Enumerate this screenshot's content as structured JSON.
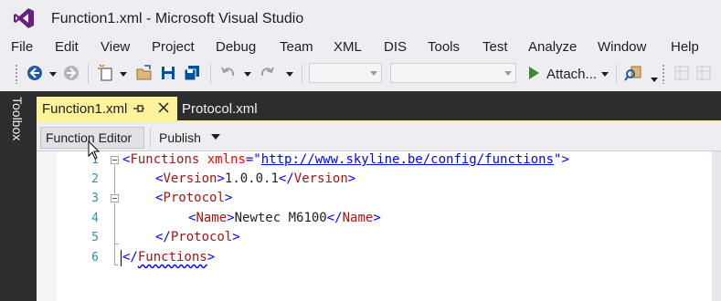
{
  "window": {
    "title": "Function1.xml - Microsoft Visual Studio"
  },
  "menu": [
    "File",
    "Edit",
    "View",
    "Project",
    "Debug",
    "Team",
    "XML",
    "DIS",
    "Tools",
    "Test",
    "Analyze",
    "Window",
    "Help"
  ],
  "toolbar": {
    "attach_label": "Attach..."
  },
  "toolbox": {
    "label": "Toolbox"
  },
  "tabs": [
    {
      "label": "Function1.xml",
      "active": true
    },
    {
      "label": "Protocol.xml",
      "active": false
    }
  ],
  "editor_toolbar": {
    "function_editor_label": "Function Editor",
    "publish_label": "Publish"
  },
  "code_lines": [
    {
      "num": "1",
      "open": "<",
      "tag": "Functions",
      "attr_name": " xmlns",
      "eq": "=\"",
      "url": "http://www.skyline.be/config/functions",
      "end": "\">"
    },
    {
      "num": "2",
      "open": "<",
      "tag": "Version",
      "close": ">",
      "text": "1.0.0.1",
      "etag_open": "</",
      "etag": "Version",
      "etag_close": ">"
    },
    {
      "num": "3",
      "open": "<",
      "tag": "Protocol",
      "close": ">"
    },
    {
      "num": "4",
      "open": "<",
      "tag": "Name",
      "close": ">",
      "text": "Newtec M6100",
      "etag_open": "</",
      "etag": "Name",
      "etag_close": ">"
    },
    {
      "num": "5",
      "open": "</",
      "tag": "Protocol",
      "close": ">"
    },
    {
      "num": "6",
      "open": "</",
      "tag": "Functions",
      "close": ">"
    }
  ],
  "colors": {
    "accent": "#68217a",
    "tab_active": "#fff29d",
    "dark_chrome": "#2d2d30",
    "line_numbers": "#2b91af"
  }
}
